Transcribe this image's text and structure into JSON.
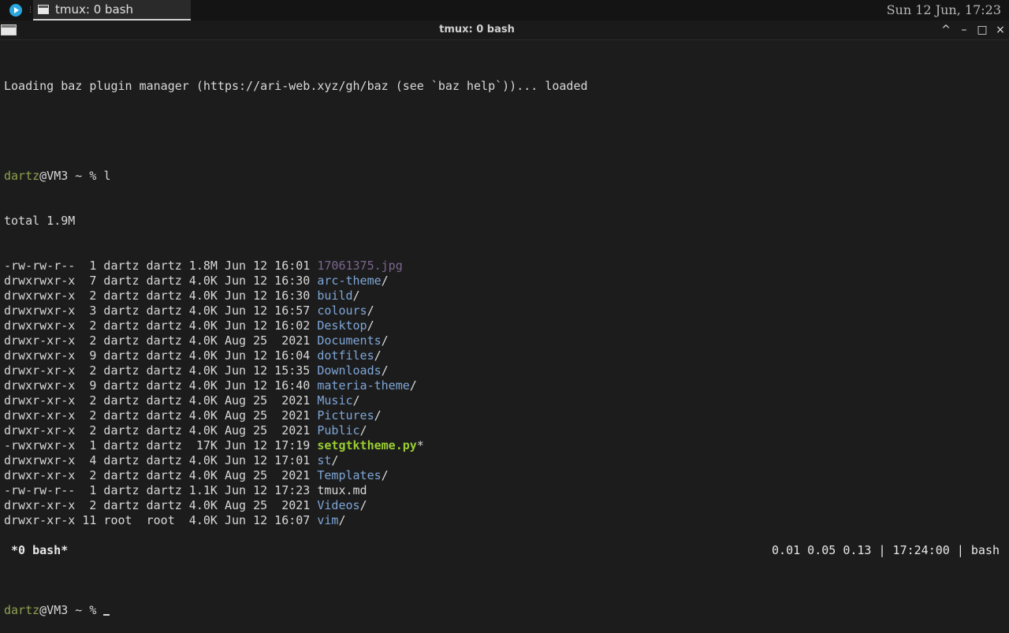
{
  "panel": {
    "task_label": "tmux: 0 bash",
    "clock": "Sun 12 Jun, 17:23"
  },
  "window": {
    "title": "tmux: 0 bash",
    "buttons": [
      "^",
      "–",
      "□",
      "×"
    ]
  },
  "terminal": {
    "loading_line": "Loading baz plugin manager (https://ari-web.xyz/gh/baz (see `baz help`))... loaded",
    "prompt_user": "dartz",
    "prompt_rest": "@VM3 ~ % ",
    "command": "l",
    "total": "total 1.9M",
    "listing": [
      {
        "meta": "-rw-rw-r--  1 dartz dartz 1.8M Jun 12 16:01 ",
        "name": "17061375.jpg",
        "suffix": "",
        "kind": "img"
      },
      {
        "meta": "drwxrwxr-x  7 dartz dartz 4.0K Jun 12 16:30 ",
        "name": "arc-theme",
        "suffix": "/",
        "kind": "dir"
      },
      {
        "meta": "drwxrwxr-x  2 dartz dartz 4.0K Jun 12 16:30 ",
        "name": "build",
        "suffix": "/",
        "kind": "dir"
      },
      {
        "meta": "drwxrwxr-x  3 dartz dartz 4.0K Jun 12 16:57 ",
        "name": "colours",
        "suffix": "/",
        "kind": "dir"
      },
      {
        "meta": "drwxrwxr-x  2 dartz dartz 4.0K Jun 12 16:02 ",
        "name": "Desktop",
        "suffix": "/",
        "kind": "dir"
      },
      {
        "meta": "drwxr-xr-x  2 dartz dartz 4.0K Aug 25  2021 ",
        "name": "Documents",
        "suffix": "/",
        "kind": "dir"
      },
      {
        "meta": "drwxrwxr-x  9 dartz dartz 4.0K Jun 12 16:04 ",
        "name": "dotfiles",
        "suffix": "/",
        "kind": "dir"
      },
      {
        "meta": "drwxr-xr-x  2 dartz dartz 4.0K Jun 12 15:35 ",
        "name": "Downloads",
        "suffix": "/",
        "kind": "dir"
      },
      {
        "meta": "drwxrwxr-x  9 dartz dartz 4.0K Jun 12 16:40 ",
        "name": "materia-theme",
        "suffix": "/",
        "kind": "dir"
      },
      {
        "meta": "drwxr-xr-x  2 dartz dartz 4.0K Aug 25  2021 ",
        "name": "Music",
        "suffix": "/",
        "kind": "dir"
      },
      {
        "meta": "drwxr-xr-x  2 dartz dartz 4.0K Aug 25  2021 ",
        "name": "Pictures",
        "suffix": "/",
        "kind": "dir"
      },
      {
        "meta": "drwxr-xr-x  2 dartz dartz 4.0K Aug 25  2021 ",
        "name": "Public",
        "suffix": "/",
        "kind": "dir"
      },
      {
        "meta": "-rwxrwxr-x  1 dartz dartz  17K Jun 12 17:19 ",
        "name": "setgtktheme.py",
        "suffix": "*",
        "kind": "exec"
      },
      {
        "meta": "drwxrwxr-x  4 dartz dartz 4.0K Jun 12 17:01 ",
        "name": "st",
        "suffix": "/",
        "kind": "dir"
      },
      {
        "meta": "drwxr-xr-x  2 dartz dartz 4.0K Aug 25  2021 ",
        "name": "Templates",
        "suffix": "/",
        "kind": "dir"
      },
      {
        "meta": "-rw-rw-r--  1 dartz dartz 1.1K Jun 12 17:23 ",
        "name": "tmux.md",
        "suffix": "",
        "kind": "plain"
      },
      {
        "meta": "drwxr-xr-x  2 dartz dartz 4.0K Aug 25  2021 ",
        "name": "Videos",
        "suffix": "/",
        "kind": "dir"
      },
      {
        "meta": "drwxr-xr-x 11 root  root  4.0K Jun 12 16:07 ",
        "name": "vim",
        "suffix": "/",
        "kind": "dir"
      }
    ]
  },
  "status": {
    "left": "*0 bash*",
    "right": "0.01 0.05 0.13 | 17:24:00 | bash"
  },
  "colors": {
    "background": "#1c1c1c",
    "directory": "#7ea6d8",
    "image": "#7a6690",
    "executable": "#9acd32",
    "prompt_user": "#8fa14e"
  }
}
